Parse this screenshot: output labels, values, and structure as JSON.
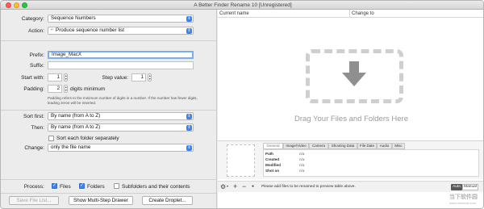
{
  "window": {
    "title": "A Better Finder Rename 10 [Unregistered]"
  },
  "left": {
    "category_label": "Category:",
    "category_value": "Sequence Numbers",
    "action_label": "Action:",
    "action_value": "Produce sequence number list",
    "prefix_label": "Prefix:",
    "prefix_value": "Image_MacX",
    "suffix_label": "Suffix:",
    "suffix_value": "",
    "start_label": "Start with:",
    "start_value": "1",
    "step_label": "Step value:",
    "step_value": "1",
    "padding_label": "Padding:",
    "padding_value": "2",
    "padding_suffix": "digits minimum",
    "padding_note": "Padding refers to the minimum number of digits in a number. If the number has fewer digits, leading zeros will be inserted.",
    "sort_first_label": "Sort first:",
    "sort_first_value": "By name (from A to Z)",
    "then_label": "Then:",
    "then_value": "By name (from A to Z)",
    "sort_each_label": "Sort each folder separately",
    "change_label": "Change:",
    "change_value": "only the file name",
    "process_label": "Process:",
    "files_label": "Files",
    "folders_label": "Folders",
    "subfolders_label": "Subfolders and their contents"
  },
  "buttons": {
    "save_file_list": "Save File List...",
    "multi_step": "Show Multi-Step Drawer",
    "droplet": "Create Droplet..."
  },
  "right": {
    "col_current": "Current name",
    "col_change": "Change to",
    "drop_text": "Drag Your Files and Folders Here",
    "tabs": [
      "General",
      "Image/Video",
      "Camera",
      "Shooting Data",
      "File Date",
      "Audio",
      "Misc"
    ],
    "meta_rows": [
      {
        "key": "Path",
        "val": "n/a"
      },
      {
        "key": "Created",
        "val": "n/a"
      },
      {
        "key": "Modified",
        "val": "n/a"
      },
      {
        "key": "Shot on",
        "val": "n/a"
      }
    ],
    "status_text": "Please add files to be renamed to preview table above.",
    "mode_auto": "Auto",
    "mode_manual": "Manual"
  },
  "watermark": {
    "text": "当下软件园",
    "sub": "www.downxia.com"
  },
  "icons": {
    "dropdown": "chevron-updown-icon",
    "drop_area": "download-arrow-icon",
    "gear": "gear-icon",
    "add": "plus-icon",
    "remove": "minus-icon"
  },
  "colors": {
    "accent": "#3b82f6"
  }
}
